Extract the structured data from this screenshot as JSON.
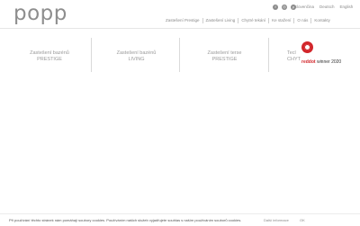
{
  "brand": {
    "logo_text": "popp"
  },
  "header": {
    "social_icons": [
      "facebook-icon",
      "instagram-icon",
      "pinterest-icon"
    ],
    "languages": [
      "Slovenčina",
      "Deutsch",
      "English"
    ],
    "nav": [
      "Zastešení Prestige",
      "Zastešení Living",
      "Chytré tekání",
      "Ke stažení",
      "O nás",
      "Kontakty"
    ]
  },
  "columns": [
    {
      "line1": "Zastešení bazénů",
      "line2": "PRESTIGE"
    },
    {
      "line1": "Zastešení bazénů",
      "line2": "LIVING"
    },
    {
      "line1": "Zastešení terse",
      "line2": "PRESTIGE"
    },
    {
      "line1": "Tecl",
      "line2": "CHYT"
    }
  ],
  "award": {
    "brand": "reddot",
    "label": "winner 2020"
  },
  "cookie": {
    "message": "Při používání těchto stránek nám pomáhají soubory cookies. Používáním našich služeb vyjadřujete souhlas s naším používáním souborů cookies.",
    "more_label": "Další informace",
    "ok_label": "OK"
  }
}
